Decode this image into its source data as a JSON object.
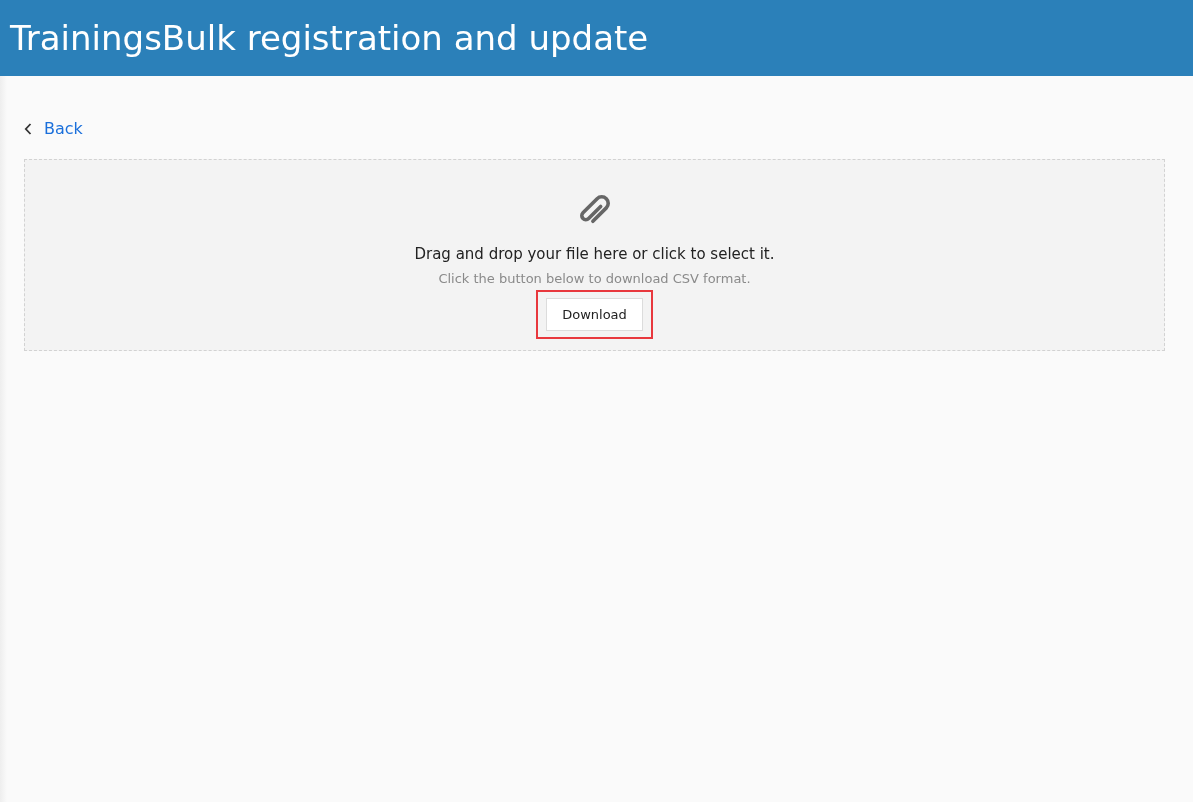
{
  "header": {
    "title": "TrainingsBulk registration and update"
  },
  "back_link": {
    "label": "Back"
  },
  "dropzone": {
    "instruction": "Drag and drop your file here or click to select it.",
    "hint": "Click the button below to download CSV format.",
    "download_button": {
      "label": "Download",
      "highlighted": true
    }
  }
}
